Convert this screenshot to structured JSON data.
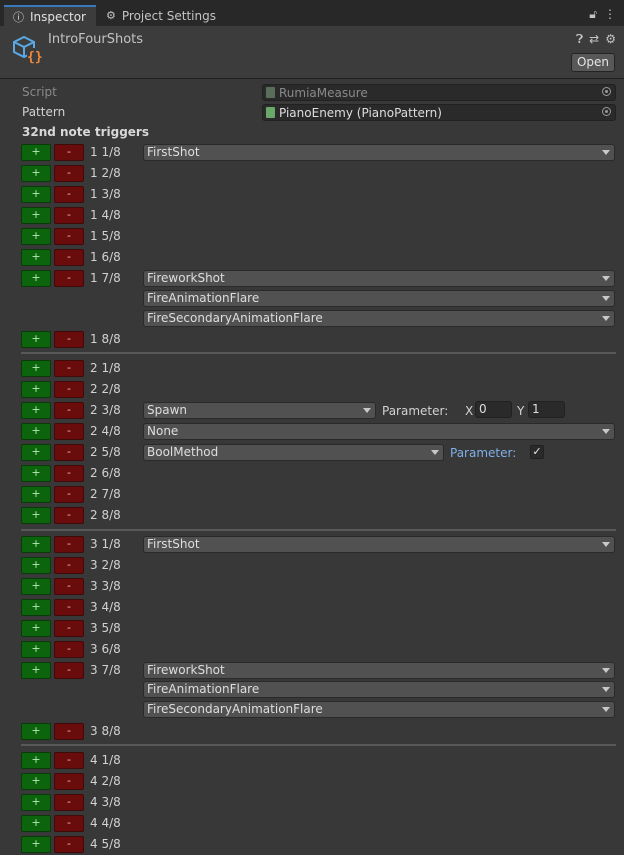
{
  "tabs": {
    "inspector": "Inspector",
    "project_settings": "Project Settings"
  },
  "header": {
    "object_name": "IntroFourShots",
    "open_label": "Open"
  },
  "fields": {
    "script_label": "Script",
    "script_value": "RumiaMeasure",
    "pattern_label": "Pattern",
    "pattern_value": "PianoEnemy (PianoPattern)"
  },
  "section_title": "32nd note triggers",
  "buttons": {
    "plus": "+",
    "minus": "-"
  },
  "rows": [
    {
      "label": "1 1/8",
      "dropdowns": [
        "FirstShot"
      ]
    },
    {
      "label": "1 2/8"
    },
    {
      "label": "1 3/8"
    },
    {
      "label": "1 4/8"
    },
    {
      "label": "1 5/8"
    },
    {
      "label": "1 6/8"
    },
    {
      "label": "1 7/8",
      "dropdowns": [
        "FireworkShot",
        "FireAnimationFlare",
        "FireSecondaryAnimationFlare"
      ]
    },
    {
      "label": "1 8/8"
    },
    {
      "label": "2 1/8"
    },
    {
      "label": "2 2/8"
    },
    {
      "label": "2 3/8",
      "dropdowns": [
        "Spawn"
      ],
      "param": {
        "label": "Parameter:",
        "x_label": "X",
        "x_value": "0",
        "y_label": "Y",
        "y_value": "1"
      }
    },
    {
      "label": "2 4/8",
      "dropdowns": [
        "None"
      ]
    },
    {
      "label": "2 5/8",
      "dropdowns": [
        "BoolMethod"
      ],
      "param": {
        "label": "Parameter:",
        "checked": "✓"
      }
    },
    {
      "label": "2 6/8"
    },
    {
      "label": "2 7/8"
    },
    {
      "label": "2 8/8"
    },
    {
      "label": "3 1/8",
      "dropdowns": [
        "FirstShot"
      ]
    },
    {
      "label": "3 2/8"
    },
    {
      "label": "3 3/8"
    },
    {
      "label": "3 4/8"
    },
    {
      "label": "3 5/8"
    },
    {
      "label": "3 6/8"
    },
    {
      "label": "3 7/8",
      "dropdowns": [
        "FireworkShot",
        "FireAnimationFlare",
        "FireSecondaryAnimationFlare"
      ]
    },
    {
      "label": "3 8/8"
    },
    {
      "label": "4 1/8"
    },
    {
      "label": "4 2/8"
    },
    {
      "label": "4 3/8"
    },
    {
      "label": "4 4/8"
    },
    {
      "label": "4 5/8"
    }
  ]
}
